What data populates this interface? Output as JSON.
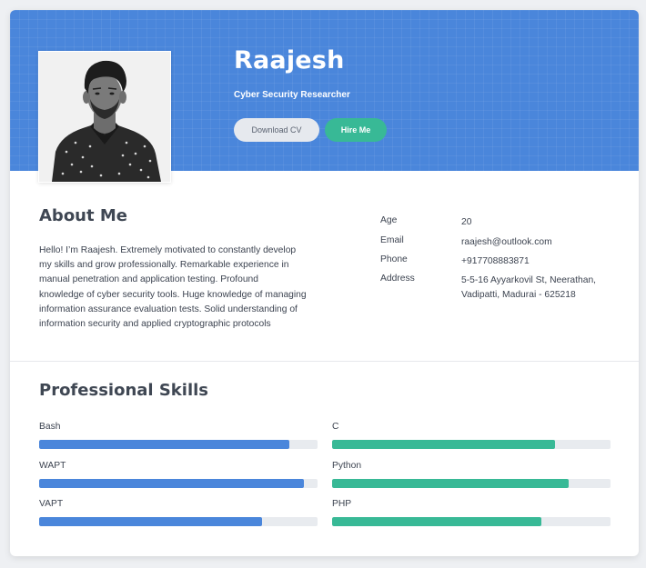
{
  "profile": {
    "name": "Raajesh",
    "title": "Cyber Security Researcher",
    "download_cv_label": "Download CV",
    "hire_me_label": "Hire Me"
  },
  "about": {
    "heading": "About Me",
    "lines": [
      "Hello! I’m Raajesh. Extremely motivated to constantly develop",
      "my skills and grow professionally. Remarkable experience in",
      "manual penetration and application testing. Profound",
      "knowledge of cyber security tools. Huge knowledge of managing",
      "information assurance evaluation tests. Solid understanding of",
      "information security and applied cryptographic protocols"
    ]
  },
  "info": [
    {
      "label": "Age",
      "value_lines": [
        "20"
      ]
    },
    {
      "label": "Email",
      "value_lines": [
        "raajesh@outlook.com"
      ]
    },
    {
      "label": "Phone",
      "value_lines": [
        "+917708883871"
      ]
    },
    {
      "label": "Address",
      "value_lines": [
        "5-5-16 Ayyarkovil St, Neerathan,",
        "Vadipatti, Madurai - 625218"
      ]
    }
  ],
  "skills": {
    "heading": "Professional Skills",
    "items": [
      {
        "name": "Bash",
        "level": 0.9,
        "color": "#4a86db"
      },
      {
        "name": "C",
        "level": 0.8,
        "color": "#38b996"
      },
      {
        "name": "WAPT",
        "level": 0.95,
        "color": "#4a86db"
      },
      {
        "name": "Python",
        "level": 0.85,
        "color": "#38b996"
      },
      {
        "name": "VAPT",
        "level": 0.8,
        "color": "#4a86db"
      },
      {
        "name": "PHP",
        "level": 0.75,
        "color": "#38b996"
      }
    ]
  },
  "colors": {
    "header": "#4a86db",
    "accent": "#38b996",
    "button_secondary": "#e6e9ee"
  }
}
